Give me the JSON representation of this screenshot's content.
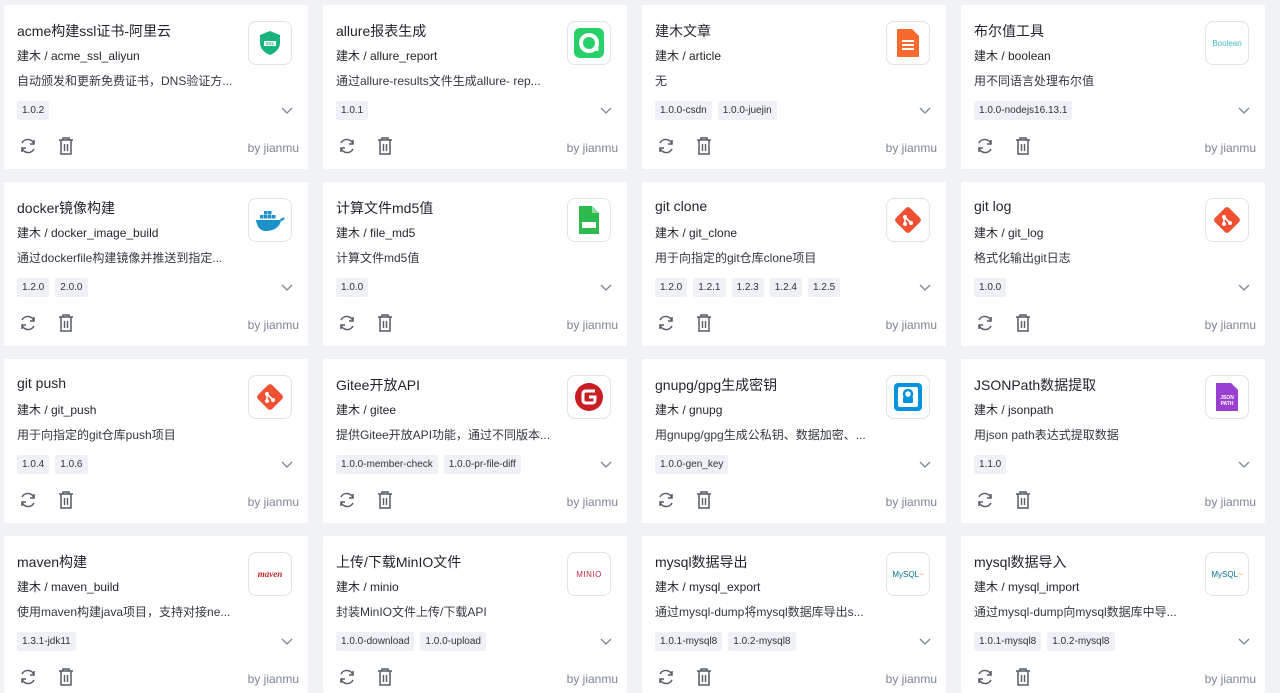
{
  "cards": [
    {
      "title": "acme构建ssl证书-阿里云",
      "ref": "建木 / acme_ssl_aliyun",
      "desc": "自动颁发和更新免费证书，DNS验证方...",
      "versions": [
        "1.0.2"
      ],
      "author": "by jianmu",
      "logo": "ssl-icon"
    },
    {
      "title": "allure报表生成",
      "ref": "建木 / allure_report",
      "desc": "通过allure-results文件生成allure- rep...",
      "versions": [
        "1.0.1"
      ],
      "author": "by jianmu",
      "logo": "allure-icon"
    },
    {
      "title": "建木文章",
      "ref": "建木 / article",
      "desc": "无",
      "versions": [
        "1.0.0-csdn",
        "1.0.0-juejin"
      ],
      "author": "by jianmu",
      "logo": "document-icon"
    },
    {
      "title": "布尔值工具",
      "ref": "建木 / boolean",
      "desc": "用不同语言处理布尔值",
      "versions": [
        "1.0.0-nodejs16.13.1"
      ],
      "author": "by jianmu",
      "logo": "boolean-icon",
      "logo_text": "Boolean"
    },
    {
      "title": "docker镜像构建",
      "ref": "建木 / docker_image_build",
      "desc": "通过dockerfile构建镜像并推送到指定...",
      "versions": [
        "1.2.0",
        "2.0.0"
      ],
      "author": "by jianmu",
      "logo": "docker-icon"
    },
    {
      "title": "计算文件md5值",
      "ref": "建木 / file_md5",
      "desc": "计算文件md5值",
      "versions": [
        "1.0.0"
      ],
      "author": "by jianmu",
      "logo": "md5-file-icon"
    },
    {
      "title": "git clone",
      "ref": "建木 / git_clone",
      "desc": "用于向指定的git仓库clone项目",
      "versions": [
        "1.2.0",
        "1.2.1",
        "1.2.3",
        "1.2.4",
        "1.2.5"
      ],
      "author": "by jianmu",
      "logo": "git-icon"
    },
    {
      "title": "git log",
      "ref": "建木 / git_log",
      "desc": "格式化输出git日志",
      "versions": [
        "1.0.0"
      ],
      "author": "by jianmu",
      "logo": "git-icon"
    },
    {
      "title": "git push",
      "ref": "建木 / git_push",
      "desc": "用于向指定的git仓库push项目",
      "versions": [
        "1.0.4",
        "1.0.6"
      ],
      "author": "by jianmu",
      "logo": "git-icon"
    },
    {
      "title": "Gitee开放API",
      "ref": "建木 / gitee",
      "desc": "提供Gitee开放API功能，通过不同版本...",
      "versions": [
        "1.0.0-member-check",
        "1.0.0-pr-file-diff"
      ],
      "author": "by jianmu",
      "logo": "gitee-icon"
    },
    {
      "title": "gnupg/gpg生成密钥",
      "ref": "建木 / gnupg",
      "desc": "用gnupg/gpg生成公私钥、数据加密、...",
      "versions": [
        "1.0.0-gen_key"
      ],
      "author": "by jianmu",
      "logo": "gnupg-icon"
    },
    {
      "title": "JSONPath数据提取",
      "ref": "建木 / jsonpath",
      "desc": "用json path表达式提取数据",
      "versions": [
        "1.1.0"
      ],
      "author": "by jianmu",
      "logo": "jsonpath-icon",
      "logo_text": "JSON PATH"
    },
    {
      "title": "maven构建",
      "ref": "建木 / maven_build",
      "desc": "使用maven构建java项目，支持对接ne...",
      "versions": [
        "1.3.1-jdk11"
      ],
      "author": "by jianmu",
      "logo": "maven-icon",
      "logo_text": "maven"
    },
    {
      "title": "上传/下载MinIO文件",
      "ref": "建木 / minio",
      "desc": "封装MinIO文件上传/下载API",
      "versions": [
        "1.0.0-download",
        "1.0.0-upload"
      ],
      "author": "by jianmu",
      "logo": "minio-icon",
      "logo_text": "MINIO"
    },
    {
      "title": "mysql数据导出",
      "ref": "建木 / mysql_export",
      "desc": "通过mysql-dump将mysql数据库导出s...",
      "versions": [
        "1.0.1-mysql8",
        "1.0.2-mysql8"
      ],
      "author": "by jianmu",
      "logo": "mysql-icon",
      "logo_text": "MySQL"
    },
    {
      "title": "mysql数据导入",
      "ref": "建木 / mysql_import",
      "desc": "通过mysql-dump向mysql数据库中导...",
      "versions": [
        "1.0.1-mysql8",
        "1.0.2-mysql8"
      ],
      "author": "by jianmu",
      "logo": "mysql-icon",
      "logo_text": "MySQL"
    }
  ],
  "colors": {
    "background": "#f0f2f5",
    "card": "#ffffff",
    "author": "#7c8594",
    "tag_bg": "#eef1f6"
  }
}
